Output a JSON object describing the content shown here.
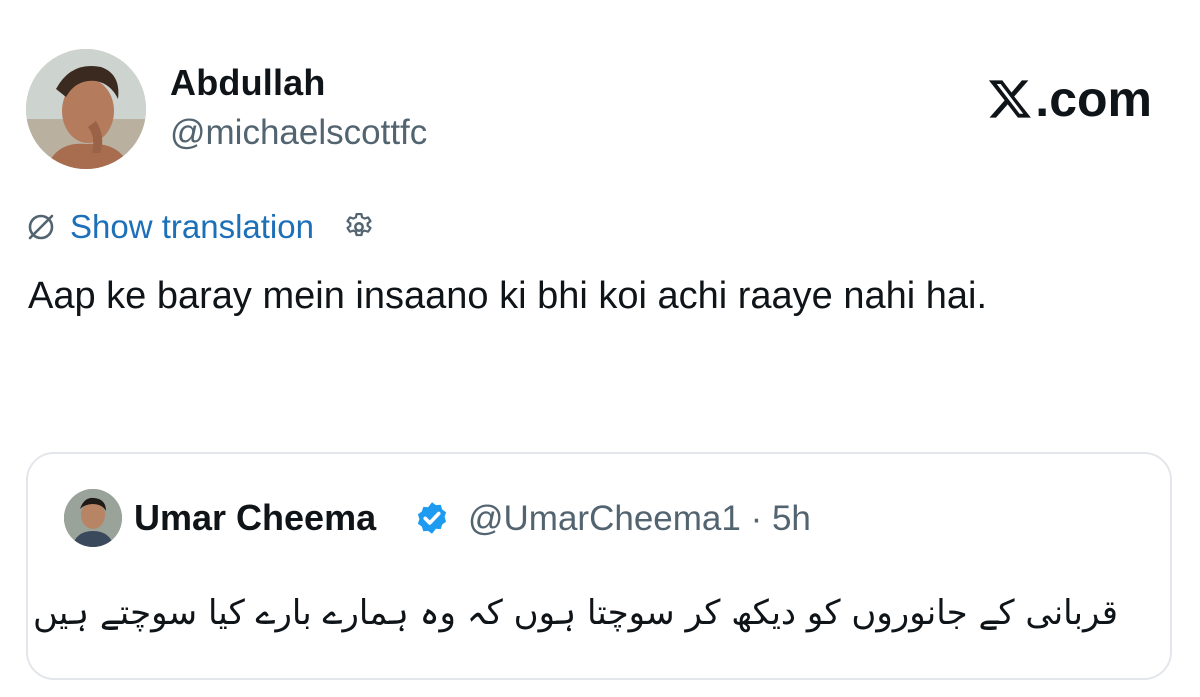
{
  "author": {
    "name": "Abdullah",
    "handle": "@michaelscottfc"
  },
  "brand": {
    "label": ".com",
    "logo_icon": "x-logo-icon"
  },
  "translation": {
    "link_label": "Show translation",
    "globe_icon": "globe-slash-icon",
    "settings_icon": "gear-icon",
    "link_color": "#1d6fb8"
  },
  "tweet": {
    "text": "Aap ke baray mein insaano ki bhi koi achi raaye nahi hai."
  },
  "quoted": {
    "name": "Umar Cheema",
    "verified_icon": "verified-badge-icon",
    "verified_color": "#1d9bf0",
    "handle": "@UmarCheema1",
    "separator": "·",
    "time": "5h",
    "text": "قربانی کے جانوروں کو دیکھ کر سوچتا ہوں کہ وہ ہمارے بارے کیا سوچتے ہیں"
  }
}
